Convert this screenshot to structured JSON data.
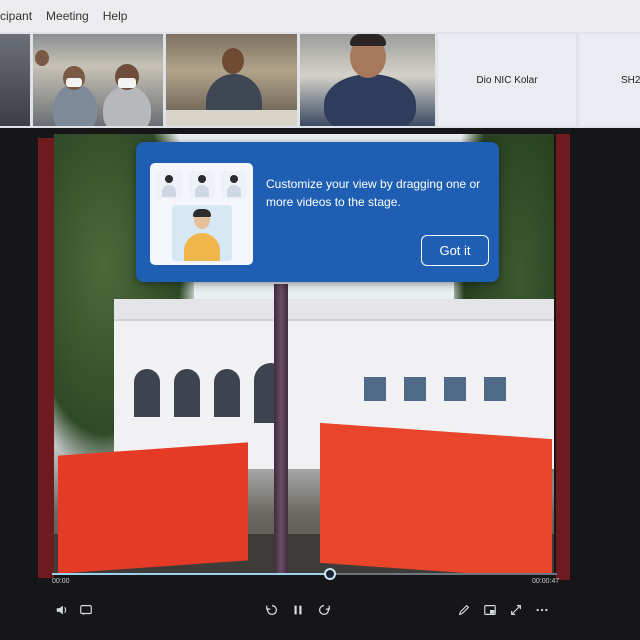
{
  "menubar": {
    "items": [
      "cipant",
      "Meeting",
      "Help"
    ]
  },
  "participants": {
    "name_tiles": [
      "Dio NIC Kolar",
      "SH2("
    ]
  },
  "popup": {
    "message": "Customize your view by dragging one or more videos to the stage.",
    "button_label": "Got it"
  },
  "player": {
    "time_elapsed": "00:00",
    "time_total": "00:00:47",
    "progress": 0.55
  },
  "colors": {
    "popup_bg": "#1f5fb3",
    "barrier": "#e53a25",
    "stage_edge": "#6d1b1f"
  }
}
